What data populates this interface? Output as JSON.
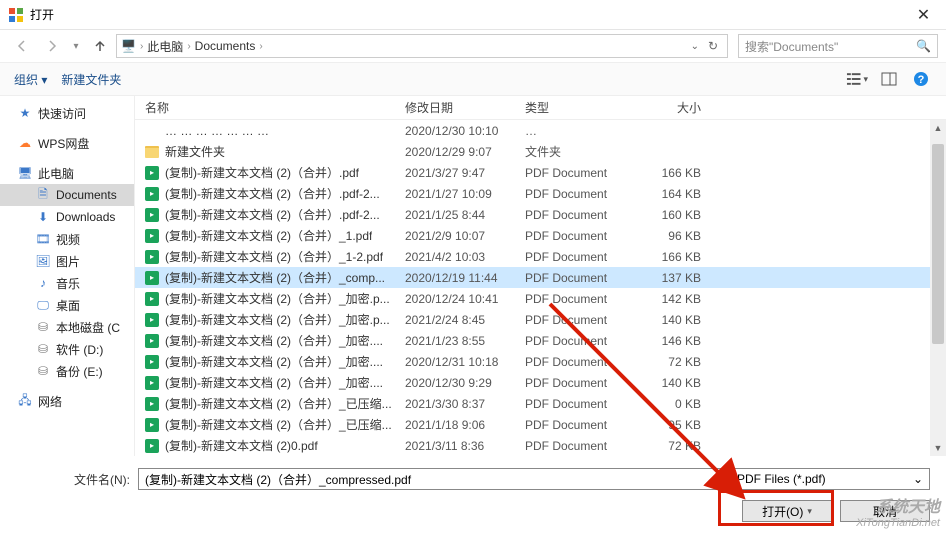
{
  "window": {
    "title": "打开"
  },
  "nav": {
    "crumb1": "此电脑",
    "crumb2": "Documents",
    "search_placeholder": "搜索\"Documents\""
  },
  "toolbar": {
    "organize": "组织 ▾",
    "newfolder": "新建文件夹"
  },
  "sidebar": {
    "quick": "快速访问",
    "wps": "WPS网盘",
    "thispc": "此电脑",
    "documents": "Documents",
    "downloads": "Downloads",
    "video": "视频",
    "pictures": "图片",
    "music": "音乐",
    "desktop": "桌面",
    "localc": "本地磁盘 (C",
    "drived": "软件 (D:)",
    "drivee": "备份 (E:)",
    "network": "网络"
  },
  "columns": {
    "name": "名称",
    "date": "修改日期",
    "type": "类型",
    "size": "大小"
  },
  "rows": [
    {
      "kind": "cut",
      "name": "… … … … … … …",
      "date": "2020/12/30 10:10",
      "type": "…",
      "size": ""
    },
    {
      "kind": "folder",
      "name": "新建文件夹",
      "date": "2020/12/29 9:07",
      "type": "文件夹",
      "size": ""
    },
    {
      "kind": "pdf",
      "name": "(复制)-新建文本文档 (2)（合并）.pdf",
      "date": "2021/3/27 9:47",
      "type": "PDF Document",
      "size": "166 KB"
    },
    {
      "kind": "pdf",
      "name": "(复制)-新建文本文档 (2)（合并）.pdf-2...",
      "date": "2021/1/27 10:09",
      "type": "PDF Document",
      "size": "164 KB"
    },
    {
      "kind": "pdf",
      "name": "(复制)-新建文本文档 (2)（合并）.pdf-2...",
      "date": "2021/1/25 8:44",
      "type": "PDF Document",
      "size": "160 KB"
    },
    {
      "kind": "pdf",
      "name": "(复制)-新建文本文档 (2)（合并）_1.pdf",
      "date": "2021/2/9 10:07",
      "type": "PDF Document",
      "size": "96 KB"
    },
    {
      "kind": "pdf",
      "name": "(复制)-新建文本文档 (2)（合并）_1-2.pdf",
      "date": "2021/4/2 10:03",
      "type": "PDF Document",
      "size": "166 KB"
    },
    {
      "kind": "pdf",
      "name": "(复制)-新建文本文档 (2)（合并）_comp...",
      "date": "2020/12/19 11:44",
      "type": "PDF Document",
      "size": "137 KB",
      "selected": true
    },
    {
      "kind": "pdf",
      "name": "(复制)-新建文本文档 (2)（合并）_加密.p...",
      "date": "2020/12/24 10:41",
      "type": "PDF Document",
      "size": "142 KB"
    },
    {
      "kind": "pdf",
      "name": "(复制)-新建文本文档 (2)（合并）_加密.p...",
      "date": "2021/2/24 8:45",
      "type": "PDF Document",
      "size": "140 KB"
    },
    {
      "kind": "pdf",
      "name": "(复制)-新建文本文档 (2)（合并）_加密....",
      "date": "2021/1/23 8:55",
      "type": "PDF Document",
      "size": "146 KB"
    },
    {
      "kind": "pdf",
      "name": "(复制)-新建文本文档 (2)（合并）_加密....",
      "date": "2020/12/31 10:18",
      "type": "PDF Document",
      "size": "72 KB"
    },
    {
      "kind": "pdf",
      "name": "(复制)-新建文本文档 (2)（合并）_加密....",
      "date": "2020/12/30 9:29",
      "type": "PDF Document",
      "size": "140 KB"
    },
    {
      "kind": "pdf",
      "name": "(复制)-新建文本文档 (2)（合并）_已压缩...",
      "date": "2021/3/30 8:37",
      "type": "PDF Document",
      "size": "0 KB"
    },
    {
      "kind": "pdf",
      "name": "(复制)-新建文本文档 (2)（合并）_已压缩...",
      "date": "2021/1/18 9:06",
      "type": "PDF Document",
      "size": "95 KB"
    },
    {
      "kind": "pdf",
      "name": "(复制)-新建文本文档 (2)0.pdf",
      "date": "2021/3/11 8:36",
      "type": "PDF Document",
      "size": "72 KB"
    }
  ],
  "footer": {
    "file_label": "文件名(N):",
    "file_value": "(复制)-新建文本文档 (2)（合并）_compressed.pdf",
    "filter": "PDF Files (*.pdf)",
    "open": "打开(O)",
    "cancel": "取消"
  },
  "watermark": {
    "l1": "系统天地",
    "l2": "XiTongTianDi.net"
  }
}
